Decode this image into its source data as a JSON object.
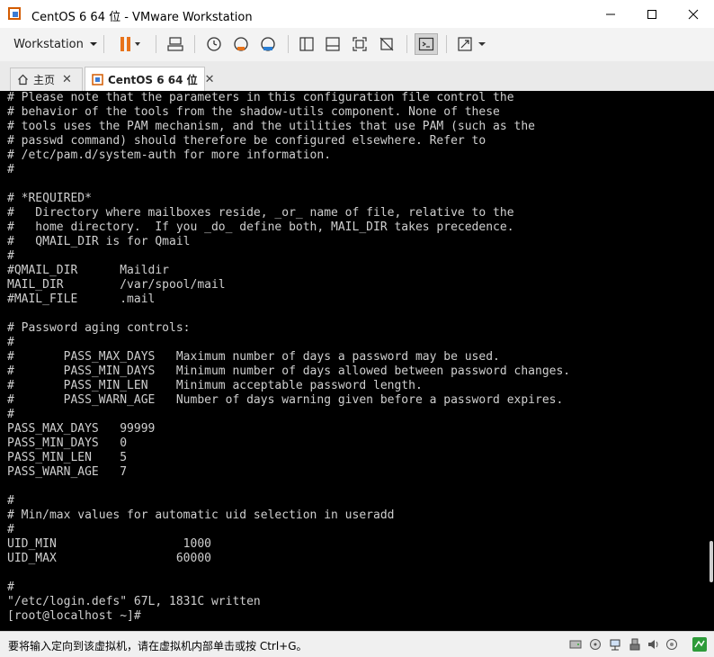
{
  "window": {
    "title": "CentOS 6 64 位 - VMware Workstation"
  },
  "toolbar": {
    "menu_label": "Workstation"
  },
  "tabs": [
    {
      "label": "主页"
    },
    {
      "label": "CentOS 6 64 位"
    }
  ],
  "console": {
    "lines": [
      "# Please note that the parameters in this configuration file control the",
      "# behavior of the tools from the shadow-utils component. None of these",
      "# tools uses the PAM mechanism, and the utilities that use PAM (such as the",
      "# passwd command) should therefore be configured elsewhere. Refer to",
      "# /etc/pam.d/system-auth for more information.",
      "#",
      "",
      "# *REQUIRED*",
      "#   Directory where mailboxes reside, _or_ name of file, relative to the",
      "#   home directory.  If you _do_ define both, MAIL_DIR takes precedence.",
      "#   QMAIL_DIR is for Qmail",
      "#",
      "#QMAIL_DIR      Maildir",
      "MAIL_DIR        /var/spool/mail",
      "#MAIL_FILE      .mail",
      "",
      "# Password aging controls:",
      "#",
      "#       PASS_MAX_DAYS   Maximum number of days a password may be used.",
      "#       PASS_MIN_DAYS   Minimum number of days allowed between password changes.",
      "#       PASS_MIN_LEN    Minimum acceptable password length.",
      "#       PASS_WARN_AGE   Number of days warning given before a password expires.",
      "#",
      "PASS_MAX_DAYS   99999",
      "PASS_MIN_DAYS   0",
      "PASS_MIN_LEN    5",
      "PASS_WARN_AGE   7",
      "",
      "#",
      "# Min/max values for automatic uid selection in useradd",
      "#",
      "UID_MIN                  1000",
      "UID_MAX                 60000",
      "",
      "#",
      "\"/etc/login.defs\" 67L, 1831C written",
      "[root@localhost ~]#"
    ]
  },
  "status": {
    "text": "要将输入定向到该虚拟机，请在虚拟机内部单击或按 Ctrl+G。"
  }
}
